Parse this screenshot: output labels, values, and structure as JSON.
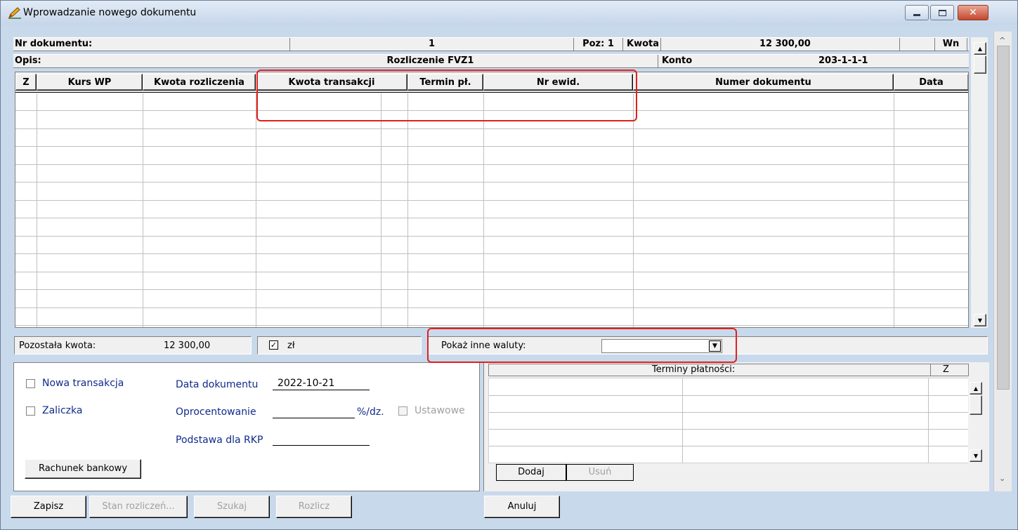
{
  "window": {
    "title": "Wprowadzanie nowego dokumentu",
    "colors": {
      "close_button": "#c4472e",
      "highlight": "#e0201e",
      "label_blue": "#102b8a"
    }
  },
  "header": {
    "nr_label": "Nr dokumentu:",
    "nr_value": "1",
    "poz": "Poz: 1",
    "kwota_label": "Kwota",
    "kwota_value": "12 300,00",
    "side": "Wn",
    "opis_label": "Opis:",
    "opis_value": "Rozliczenie FVZ1",
    "konto_label": "Konto",
    "konto_value": "203-1-1-1"
  },
  "grid": {
    "columns": [
      "Z",
      "Kurs WP",
      "Kwota rozliczenia",
      "Kwota transakcji",
      "Termin pł.",
      "Nr ewid.",
      "Numer dokumentu",
      "Data"
    ]
  },
  "status": {
    "remaining_label": "Pozostała kwota:",
    "remaining_value": "12 300,00",
    "currency_label": "zł",
    "currency_checked": true,
    "other_currencies_label": "Pokaż inne waluty:",
    "other_currencies_value": ""
  },
  "form": {
    "new_transaction": "Nowa transakcja",
    "advance": "Zaliczka",
    "doc_date_label": "Data dokumentu",
    "doc_date_value": "2022-10-21",
    "interest_label": "Oprocentowanie",
    "interest_value": "",
    "interest_unit": "%/dz.",
    "statutory": "Ustawowe",
    "rkp_label": "Podstawa dla RKP",
    "rkp_value": "",
    "bank_button": "Rachunek bankowy"
  },
  "payments": {
    "header": "Terminy płatności:",
    "z": "Z",
    "add": "Dodaj",
    "remove": "Usuń"
  },
  "buttons": {
    "save": "Zapisz",
    "status": "Stan rozliczeń...",
    "search": "Szukaj",
    "settle": "Rozlicz",
    "cancel": "Anuluj"
  }
}
